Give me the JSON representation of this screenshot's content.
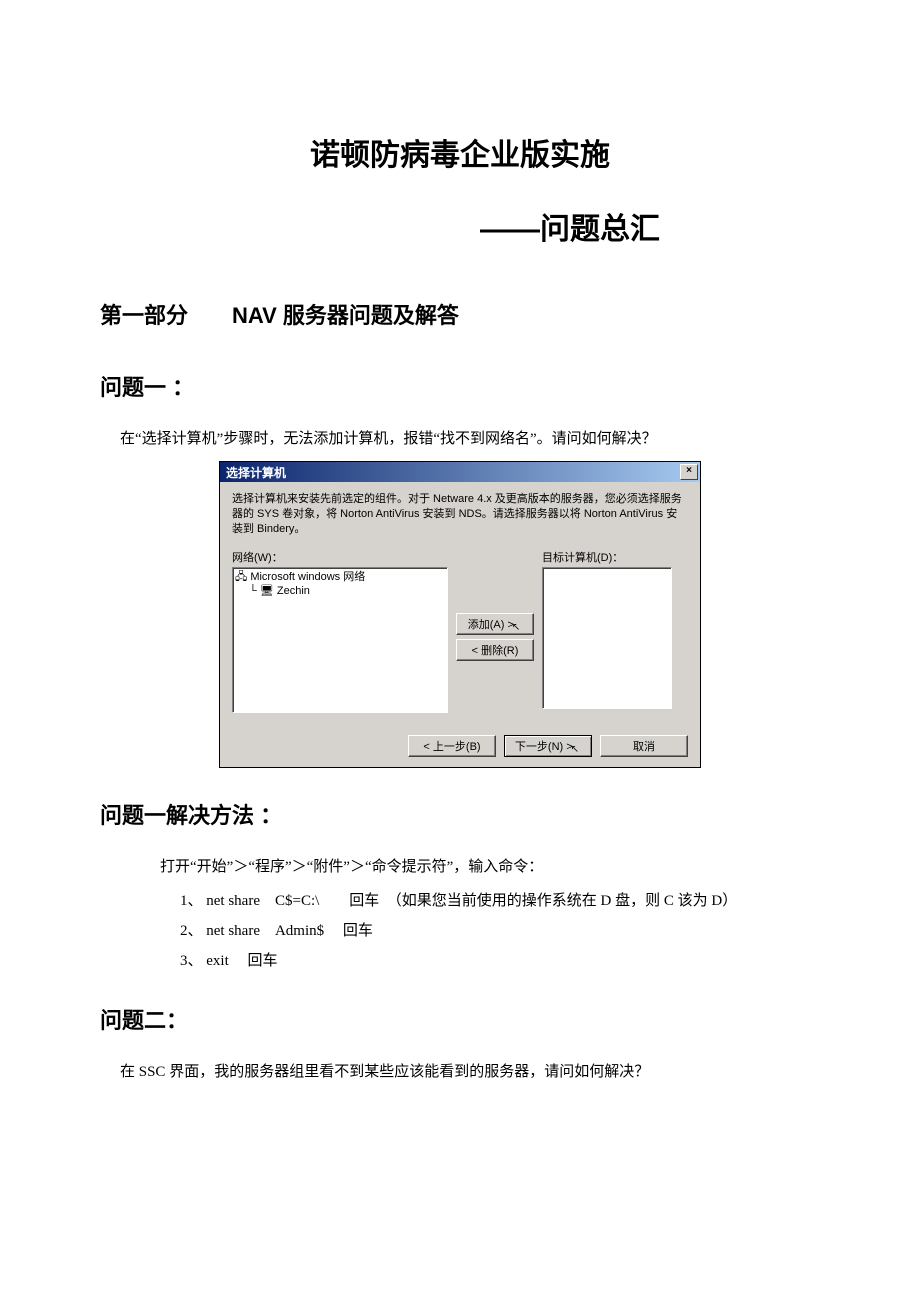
{
  "doc": {
    "title1": "诺顿防病毒企业版实施",
    "title2": "——问题总汇",
    "section1": "第一部分　　NAV  服务器问题及解答",
    "q1_heading": "问题一 ：",
    "q1_text": "在“选择计算机”步骤时，无法添加计算机，报错“找不到网络名”。请问如何解决？",
    "q1sol_heading": "问题一解决方法 ：",
    "q1sol_intro": "打开“开始”＞“程序”＞“附件”＞“命令提示符”，输入命令：",
    "q1sol_items": [
      "1、  net share　C$=C:\\　　回车　（如果您当前使用的操作系统在 D 盘，则 C 该为 D）",
      "2、  net share　Admin$　  回车",
      "3、  exit　 回车"
    ],
    "q2_heading": "问题二：",
    "q2_text": "在 SSC 界面，我的服务器组里看不到某些应该能看到的服务器，请问如何解决？"
  },
  "dialog": {
    "title": "选择计算机",
    "close": "×",
    "desc": "选择计算机来安装先前选定的组件。对于 Netware 4.x 及更高版本的服务器，您必须选择服务器的 SYS 卷对象，将 Norton AntiVirus 安装到 NDS。请选择服务器以将 Norton AntiVirus 安装到 Bindery。",
    "net_label": "网络(W)：",
    "target_label": "目标计算机(D)：",
    "tree_root": "Microsoft windows 网络",
    "tree_child": "Zechin",
    "add_btn": "添加(A) >",
    "remove_btn": "< 删除(R)",
    "back_btn": "< 上一步(B)",
    "next_btn": "下一步(N) >",
    "cancel_btn": "取消"
  }
}
